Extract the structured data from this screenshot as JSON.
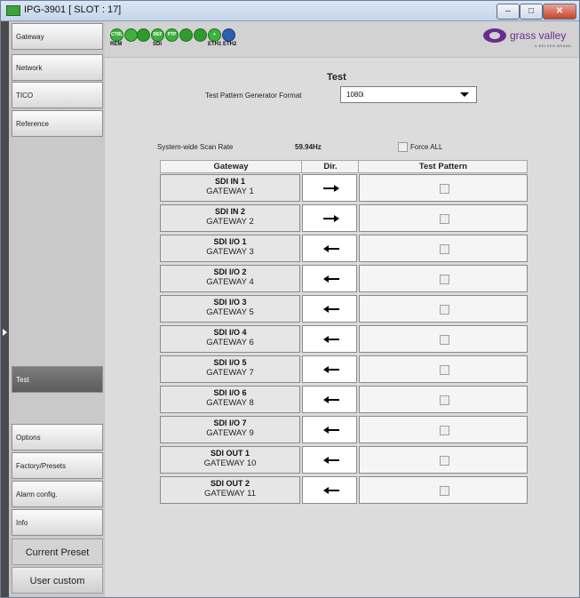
{
  "window": {
    "title": "IPG-3901 [ SLOT : 17]",
    "minimize_glyph": "–",
    "maximize_glyph": "□",
    "close_glyph": "✕"
  },
  "sidebar": {
    "items": [
      {
        "label": "Gateway"
      },
      {
        "label": "Network"
      },
      {
        "label": "TICO"
      },
      {
        "label": "Reference"
      },
      {
        "label": "Test"
      },
      {
        "label": "Options"
      },
      {
        "label": "Factory/Presets"
      },
      {
        "label": "Alarm config."
      },
      {
        "label": "Info"
      }
    ],
    "current_preset_label": "Current Preset",
    "user_custom_label": "User custom"
  },
  "status_bar": {
    "icons": [
      {
        "name": "ctrl-status-icon",
        "text": "CTRL"
      },
      {
        "name": "sdi-status-icon-1",
        "text": ""
      },
      {
        "name": "sdi-status-icon-2",
        "text": ""
      },
      {
        "name": "ref-status-icon",
        "text": "REF"
      },
      {
        "name": "ptp-status-icon",
        "text": "PTP"
      },
      {
        "name": "eth1-status-icon",
        "text": ""
      },
      {
        "name": "eth2-status-icon",
        "text": ""
      },
      {
        "name": "add-status-icon",
        "text": "+"
      },
      {
        "name": "sync-status-icon",
        "text": ""
      }
    ],
    "labels": {
      "rem": "REM",
      "sdi": "SDI",
      "eth": "ETH1 ETH2"
    },
    "logo_text": "grass valley",
    "logo_sub": "A BELDEN BRAND",
    "brand_color": "#6a2c91",
    "status_ok_color": "#3cb23c"
  },
  "test": {
    "title": "Test",
    "tpg_format_label": "Test Pattern Generator Format",
    "tpg_format_value": "1080i",
    "scan_rate_label": "System-wide Scan Rate",
    "scan_rate_value": "59.94Hz",
    "force_all_label": "Force ALL",
    "force_all_checked": false
  },
  "table": {
    "headers": {
      "gateway": "Gateway",
      "dir": "Dir.",
      "test_pattern": "Test Pattern"
    },
    "rows": [
      {
        "port": "SDI IN 1",
        "gateway": "GATEWAY 1",
        "dir": "right",
        "checked": false
      },
      {
        "port": "SDI IN 2",
        "gateway": "GATEWAY 2",
        "dir": "right",
        "checked": false
      },
      {
        "port": "SDI I/O 1",
        "gateway": "GATEWAY 3",
        "dir": "left",
        "checked": false
      },
      {
        "port": "SDI I/O 2",
        "gateway": "GATEWAY 4",
        "dir": "left",
        "checked": false
      },
      {
        "port": "SDI I/O 3",
        "gateway": "GATEWAY 5",
        "dir": "left",
        "checked": false
      },
      {
        "port": "SDI I/O 4",
        "gateway": "GATEWAY 6",
        "dir": "left",
        "checked": false
      },
      {
        "port": "SDI I/O 5",
        "gateway": "GATEWAY 7",
        "dir": "left",
        "checked": false
      },
      {
        "port": "SDI I/O 6",
        "gateway": "GATEWAY 8",
        "dir": "left",
        "checked": false
      },
      {
        "port": "SDI I/O 7",
        "gateway": "GATEWAY 9",
        "dir": "left",
        "checked": false
      },
      {
        "port": "SDI OUT 1",
        "gateway": "GATEWAY 10",
        "dir": "left",
        "checked": false
      },
      {
        "port": "SDI OUT 2",
        "gateway": "GATEWAY 11",
        "dir": "left",
        "checked": false
      }
    ]
  }
}
